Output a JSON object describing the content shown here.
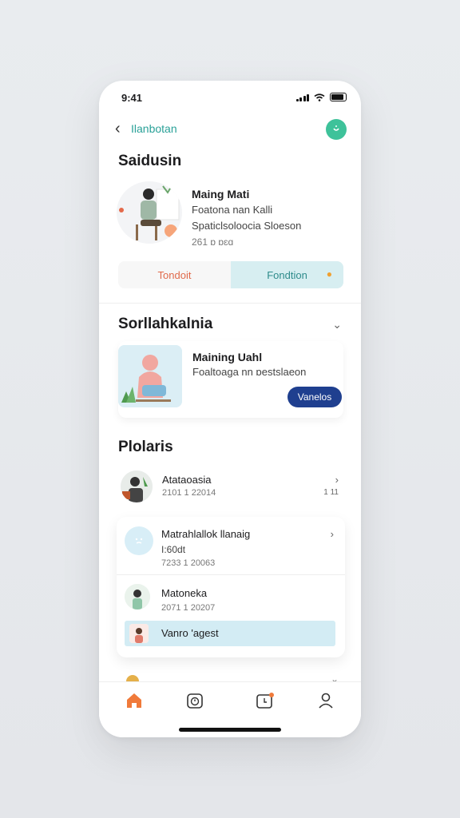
{
  "status": {
    "time": "9:41"
  },
  "header": {
    "back_icon": "chevron-left-icon",
    "title": "Ilanbotan",
    "action_icon": "smile-icon"
  },
  "section1": {
    "title": "Saidusin",
    "profile": {
      "name": "Maing Mati",
      "line1": "Foatona nan Kalli",
      "line2": "Spaticlsoloocia Sloeson",
      "date": "261 ɒ ɒɛɑ"
    },
    "segment": {
      "option1": "Tondoit",
      "option2": "Fondtion"
    }
  },
  "section2": {
    "title": "Sorllahkalnia",
    "card": {
      "name": "Maining Uahl",
      "sub": "Foaltoaga nn ɒestslaeon",
      "button": "Vanelos"
    }
  },
  "section3": {
    "title": "Plolaris",
    "items": [
      {
        "name": "Atataoasia",
        "date": "2101 1 22014",
        "meta": "1 11"
      },
      {
        "name": "Matrahlallok llanaig",
        "line": "I:60dt",
        "date": "7233 1 20063"
      },
      {
        "name": "Matoneka",
        "date": "2071 1 20207"
      },
      {
        "name": "Vanro 'agest"
      }
    ]
  },
  "tabbar": {
    "items": [
      {
        "icon": "home-icon",
        "active": true
      },
      {
        "icon": "timer-icon",
        "active": false
      },
      {
        "icon": "calendar-notification-icon",
        "active": false
      },
      {
        "icon": "profile-icon",
        "active": false
      }
    ]
  },
  "colors": {
    "accent": "#2aa198",
    "primary_button": "#1f3f8f",
    "home_active": "#f07a3a"
  }
}
